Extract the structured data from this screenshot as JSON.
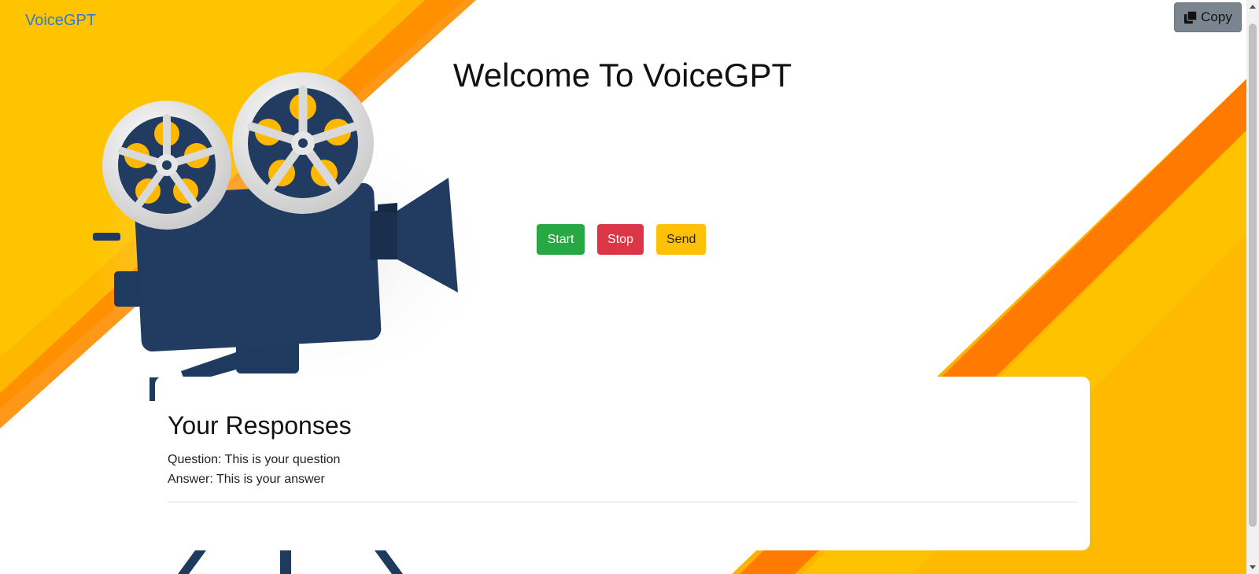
{
  "header": {
    "brand": "VoiceGPT",
    "copy_label": "Copy"
  },
  "main": {
    "title": "Welcome To VoiceGPT",
    "buttons": {
      "start": "Start",
      "stop": "Stop",
      "send": "Send"
    }
  },
  "responses": {
    "heading": "Your Responses",
    "question": "Question: This is your question",
    "answer": "Answer: This is your answer"
  },
  "icons": {
    "copy": "copy-icon",
    "camera": "film-camera-illustration"
  },
  "colors": {
    "accent_yellow": "#ffba00",
    "accent_orange": "#ff7a00",
    "start": "#28a745",
    "stop": "#dc3545",
    "send": "#ffc107",
    "brand": "#2e7bd6",
    "camera_body": "#1f3a5f"
  }
}
